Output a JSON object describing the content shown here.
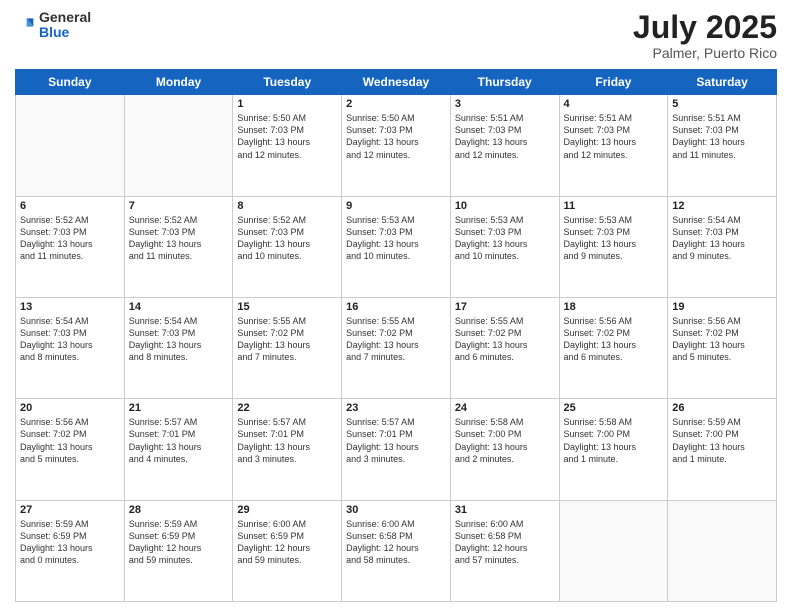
{
  "header": {
    "logo_general": "General",
    "logo_blue": "Blue",
    "month_year": "July 2025",
    "location": "Palmer, Puerto Rico"
  },
  "days_of_week": [
    "Sunday",
    "Monday",
    "Tuesday",
    "Wednesday",
    "Thursday",
    "Friday",
    "Saturday"
  ],
  "weeks": [
    [
      {
        "num": "",
        "info": ""
      },
      {
        "num": "",
        "info": ""
      },
      {
        "num": "1",
        "info": "Sunrise: 5:50 AM\nSunset: 7:03 PM\nDaylight: 13 hours\nand 12 minutes."
      },
      {
        "num": "2",
        "info": "Sunrise: 5:50 AM\nSunset: 7:03 PM\nDaylight: 13 hours\nand 12 minutes."
      },
      {
        "num": "3",
        "info": "Sunrise: 5:51 AM\nSunset: 7:03 PM\nDaylight: 13 hours\nand 12 minutes."
      },
      {
        "num": "4",
        "info": "Sunrise: 5:51 AM\nSunset: 7:03 PM\nDaylight: 13 hours\nand 12 minutes."
      },
      {
        "num": "5",
        "info": "Sunrise: 5:51 AM\nSunset: 7:03 PM\nDaylight: 13 hours\nand 11 minutes."
      }
    ],
    [
      {
        "num": "6",
        "info": "Sunrise: 5:52 AM\nSunset: 7:03 PM\nDaylight: 13 hours\nand 11 minutes."
      },
      {
        "num": "7",
        "info": "Sunrise: 5:52 AM\nSunset: 7:03 PM\nDaylight: 13 hours\nand 11 minutes."
      },
      {
        "num": "8",
        "info": "Sunrise: 5:52 AM\nSunset: 7:03 PM\nDaylight: 13 hours\nand 10 minutes."
      },
      {
        "num": "9",
        "info": "Sunrise: 5:53 AM\nSunset: 7:03 PM\nDaylight: 13 hours\nand 10 minutes."
      },
      {
        "num": "10",
        "info": "Sunrise: 5:53 AM\nSunset: 7:03 PM\nDaylight: 13 hours\nand 10 minutes."
      },
      {
        "num": "11",
        "info": "Sunrise: 5:53 AM\nSunset: 7:03 PM\nDaylight: 13 hours\nand 9 minutes."
      },
      {
        "num": "12",
        "info": "Sunrise: 5:54 AM\nSunset: 7:03 PM\nDaylight: 13 hours\nand 9 minutes."
      }
    ],
    [
      {
        "num": "13",
        "info": "Sunrise: 5:54 AM\nSunset: 7:03 PM\nDaylight: 13 hours\nand 8 minutes."
      },
      {
        "num": "14",
        "info": "Sunrise: 5:54 AM\nSunset: 7:03 PM\nDaylight: 13 hours\nand 8 minutes."
      },
      {
        "num": "15",
        "info": "Sunrise: 5:55 AM\nSunset: 7:02 PM\nDaylight: 13 hours\nand 7 minutes."
      },
      {
        "num": "16",
        "info": "Sunrise: 5:55 AM\nSunset: 7:02 PM\nDaylight: 13 hours\nand 7 minutes."
      },
      {
        "num": "17",
        "info": "Sunrise: 5:55 AM\nSunset: 7:02 PM\nDaylight: 13 hours\nand 6 minutes."
      },
      {
        "num": "18",
        "info": "Sunrise: 5:56 AM\nSunset: 7:02 PM\nDaylight: 13 hours\nand 6 minutes."
      },
      {
        "num": "19",
        "info": "Sunrise: 5:56 AM\nSunset: 7:02 PM\nDaylight: 13 hours\nand 5 minutes."
      }
    ],
    [
      {
        "num": "20",
        "info": "Sunrise: 5:56 AM\nSunset: 7:02 PM\nDaylight: 13 hours\nand 5 minutes."
      },
      {
        "num": "21",
        "info": "Sunrise: 5:57 AM\nSunset: 7:01 PM\nDaylight: 13 hours\nand 4 minutes."
      },
      {
        "num": "22",
        "info": "Sunrise: 5:57 AM\nSunset: 7:01 PM\nDaylight: 13 hours\nand 3 minutes."
      },
      {
        "num": "23",
        "info": "Sunrise: 5:57 AM\nSunset: 7:01 PM\nDaylight: 13 hours\nand 3 minutes."
      },
      {
        "num": "24",
        "info": "Sunrise: 5:58 AM\nSunset: 7:00 PM\nDaylight: 13 hours\nand 2 minutes."
      },
      {
        "num": "25",
        "info": "Sunrise: 5:58 AM\nSunset: 7:00 PM\nDaylight: 13 hours\nand 1 minute."
      },
      {
        "num": "26",
        "info": "Sunrise: 5:59 AM\nSunset: 7:00 PM\nDaylight: 13 hours\nand 1 minute."
      }
    ],
    [
      {
        "num": "27",
        "info": "Sunrise: 5:59 AM\nSunset: 6:59 PM\nDaylight: 13 hours\nand 0 minutes."
      },
      {
        "num": "28",
        "info": "Sunrise: 5:59 AM\nSunset: 6:59 PM\nDaylight: 12 hours\nand 59 minutes."
      },
      {
        "num": "29",
        "info": "Sunrise: 6:00 AM\nSunset: 6:59 PM\nDaylight: 12 hours\nand 59 minutes."
      },
      {
        "num": "30",
        "info": "Sunrise: 6:00 AM\nSunset: 6:58 PM\nDaylight: 12 hours\nand 58 minutes."
      },
      {
        "num": "31",
        "info": "Sunrise: 6:00 AM\nSunset: 6:58 PM\nDaylight: 12 hours\nand 57 minutes."
      },
      {
        "num": "",
        "info": ""
      },
      {
        "num": "",
        "info": ""
      }
    ]
  ]
}
